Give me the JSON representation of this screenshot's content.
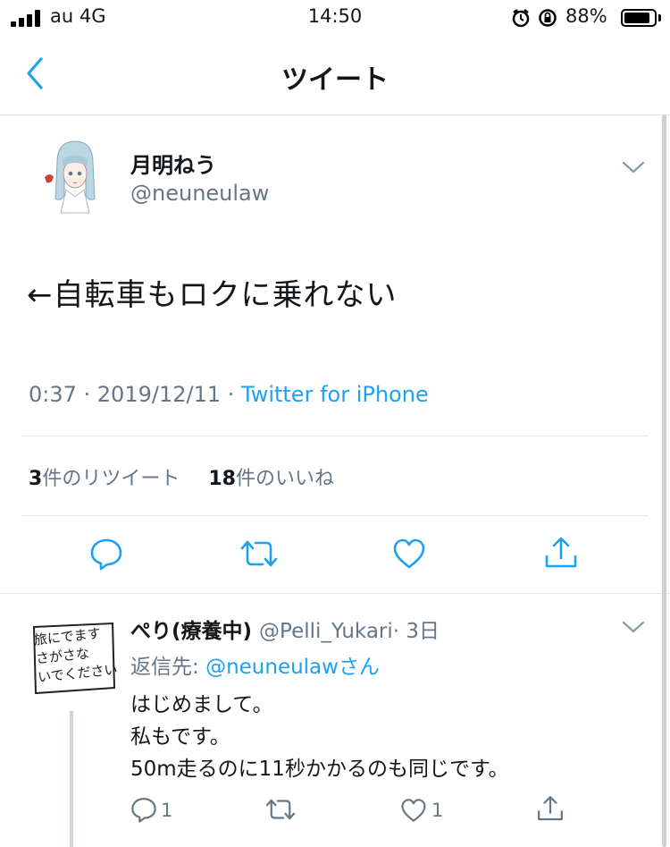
{
  "status_bar": {
    "carrier": "au 4G",
    "time": "14:50",
    "battery_percent": "88%",
    "battery_level": 0.88,
    "signal_icon": "signal-bars-icon",
    "alarm_icon": "alarm-clock-icon",
    "lock_icon": "rotation-lock-icon"
  },
  "nav": {
    "title": "ツイート",
    "back_icon": "chevron-left-icon"
  },
  "tweet": {
    "display_name": "月明ねう",
    "handle": "@neuneulaw",
    "text": "←自転車もロクに乗れない",
    "time": "0:37 · 2019/12/11 · ",
    "source": "Twitter for iPhone",
    "retweet_count": "3",
    "retweet_label": "件のリツイート",
    "like_count": "18",
    "like_label": "件のいいね",
    "actions": [
      "reply-icon",
      "retweet-icon",
      "heart-icon",
      "share-icon"
    ]
  },
  "reply": {
    "display_name": "ぺり(療養中)",
    "handle": "@Pelli_Yukari",
    "age": "· 3日",
    "reply_to_label": "返信先: ",
    "reply_to_handle": "@neuneulaw",
    "reply_to_suffix": "さん",
    "lines": [
      "はじめまして。",
      "私もです。",
      "50m走るのに11秒かかるのも同じです。"
    ],
    "avatar_text": [
      "旅にでます",
      "さがさな",
      "いでください"
    ],
    "reply_count": "1",
    "retweet_count": "",
    "like_count": "1"
  },
  "colors": {
    "accent": "#1da1f2",
    "secondary_text": "#657786",
    "icon": "#1da1f2"
  }
}
